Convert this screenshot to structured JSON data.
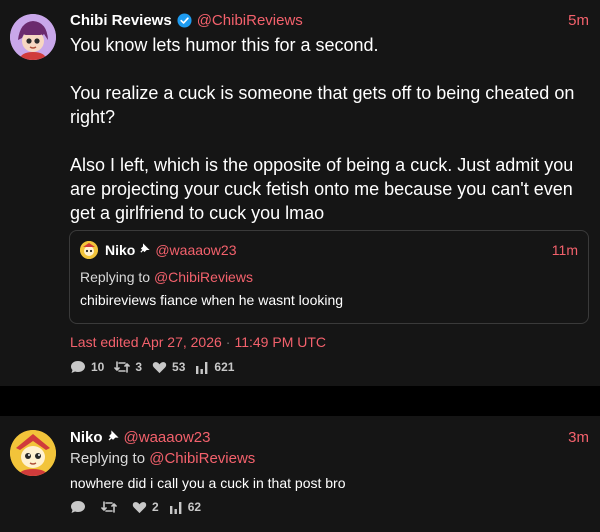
{
  "post": {
    "author_name": "Chibi Reviews",
    "author_handle": "@ChibiReviews",
    "time": "5m",
    "paragraphs": [
      "You know lets humor this for a second.",
      "You realize a cuck is someone that gets off to being cheated on right?",
      "Also I left, which is the opposite of being a cuck. Just admit you are projecting your cuck fetish onto me because you can't even get a girlfriend to cuck you lmao"
    ],
    "quote": {
      "author_name": "Niko",
      "author_handle": "@waaaow23",
      "time": "11m",
      "replying_label": "Replying to",
      "replying_handle": "@ChibiReviews",
      "text": "chibireviews fiance when he wasnt looking"
    },
    "edited_label": "Last edited Apr 27, 2026",
    "edited_separator": "·",
    "edited_time": "11:49 PM UTC",
    "stats": {
      "replies": "10",
      "reposts": "3",
      "likes": "53",
      "views": "621"
    }
  },
  "reply": {
    "author_name": "Niko",
    "author_handle": "@waaaow23",
    "time": "3m",
    "replying_label": "Replying to",
    "replying_handle": "@ChibiReviews",
    "text": "nowhere did i call you a cuck in that post bro",
    "stats": {
      "replies": "",
      "reposts": "",
      "likes": "2",
      "views": "62"
    }
  },
  "icons": {
    "verified": "verified-badge-icon",
    "pin": "pin-icon",
    "reply": "reply-icon",
    "repost": "repost-icon",
    "like": "heart-icon",
    "views": "views-bar-icon"
  },
  "colors": {
    "accent": "#f3616c",
    "verified": "#1d9bf0",
    "background": "#151515"
  }
}
